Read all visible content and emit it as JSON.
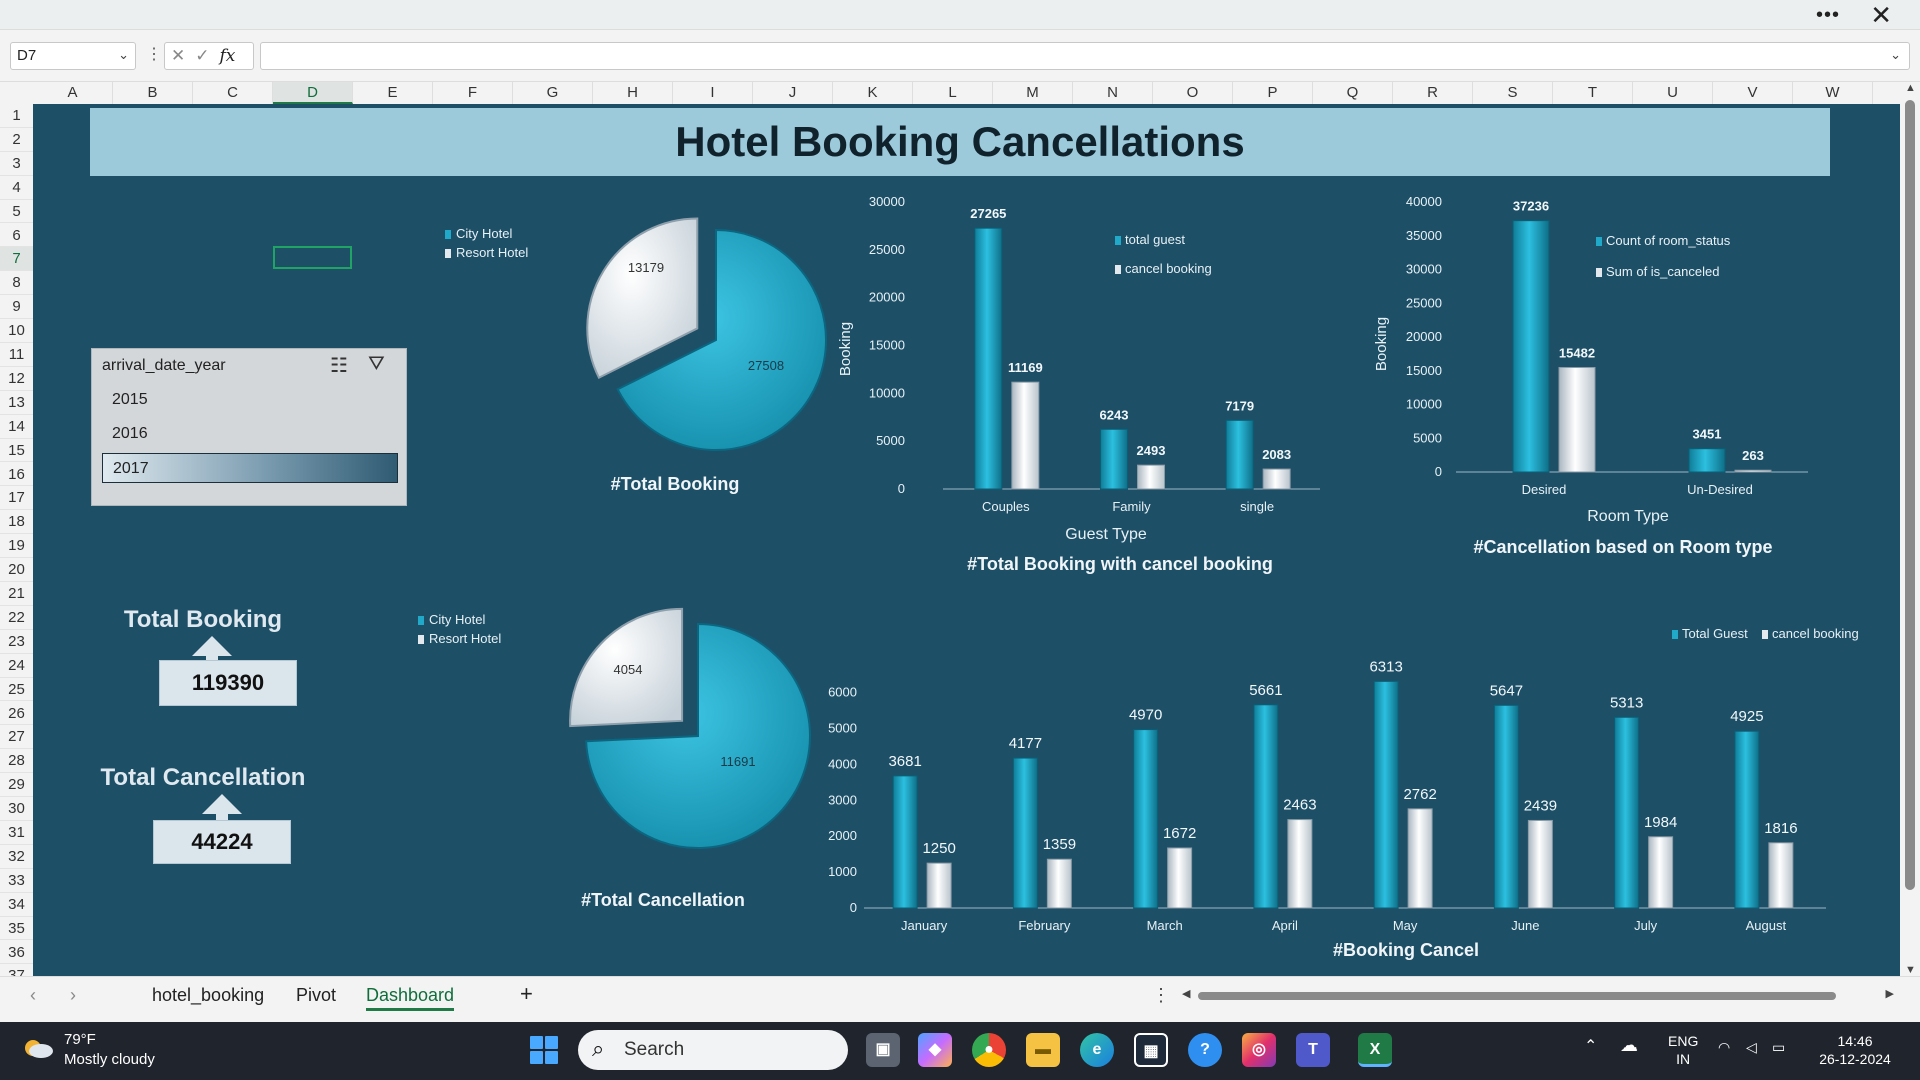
{
  "formula_bar": {
    "name_box": "D7",
    "formula": "",
    "fx": "fx"
  },
  "columns": [
    "A",
    "B",
    "C",
    "D",
    "E",
    "F",
    "G",
    "H",
    "I",
    "J",
    "K",
    "L",
    "M",
    "N",
    "O",
    "P",
    "Q",
    "R",
    "S",
    "T",
    "U",
    "V",
    "W"
  ],
  "rows": [
    "1",
    "2",
    "3",
    "4",
    "5",
    "6",
    "7",
    "8",
    "9",
    "10",
    "11",
    "12",
    "13",
    "14",
    "15",
    "16",
    "17",
    "18",
    "19",
    "20",
    "21",
    "22",
    "23",
    "24",
    "25",
    "26",
    "27",
    "28",
    "29",
    "30",
    "31",
    "32",
    "33",
    "34",
    "35",
    "36",
    "37"
  ],
  "dashboard": {
    "title": "Hotel Booking Cancellations",
    "slicer": {
      "header": "arrival_date_year",
      "items": [
        "2015",
        "2016",
        "2017"
      ],
      "selected": "2017"
    },
    "kpi": {
      "total_booking_label": "Total Booking",
      "total_booking_value": "119390",
      "total_cancellation_label": "Total Cancellation",
      "total_cancellation_value": "44224"
    }
  },
  "chart_data": [
    {
      "type": "pie",
      "title": "#Total Booking",
      "legend": [
        "City Hotel",
        "Resort Hotel"
      ],
      "legend_position": "top-left",
      "values": [
        27508,
        13179
      ],
      "labels": [
        "27508",
        "13179"
      ],
      "colors": [
        "#21a9c9",
        "#e2e8ee"
      ]
    },
    {
      "type": "pie",
      "title": "#Total Cancellation",
      "legend": [
        "City Hotel",
        "Resort Hotel"
      ],
      "legend_position": "top-left",
      "values": [
        11691,
        4054
      ],
      "labels": [
        "11691",
        "4054"
      ],
      "colors": [
        "#21a9c9",
        "#e2e8ee"
      ]
    },
    {
      "type": "bar",
      "title": "#Total Booking with cancel booking",
      "xlabel": "Guest Type",
      "ylabel": "Booking",
      "categories": [
        "Couples",
        "Family",
        "single"
      ],
      "series": [
        {
          "name": "total guest",
          "values": [
            27265,
            6243,
            7179
          ]
        },
        {
          "name": "cancel booking",
          "values": [
            11169,
            2493,
            2083
          ]
        }
      ],
      "ylim": [
        0,
        30000
      ],
      "yticks": [
        "0",
        "5000",
        "10000",
        "15000",
        "20000",
        "25000",
        "30000"
      ],
      "legend_position": "top-right"
    },
    {
      "type": "bar",
      "title": "#Cancellation based on Room type",
      "xlabel": "Room Type",
      "ylabel": "Booking",
      "categories": [
        "Desired",
        "Un-Desired"
      ],
      "series": [
        {
          "name": "Count of room_status",
          "values": [
            37236,
            3451
          ]
        },
        {
          "name": "Sum of is_canceled",
          "values": [
            15482,
            263
          ]
        }
      ],
      "ylim": [
        0,
        40000
      ],
      "yticks": [
        "0",
        "5000",
        "10000",
        "15000",
        "20000",
        "25000",
        "30000",
        "35000",
        "40000"
      ],
      "legend_position": "top-right"
    },
    {
      "type": "bar",
      "title": "#Booking Cancel",
      "xlabel": "",
      "ylabel": "",
      "categories": [
        "January",
        "February",
        "March",
        "April",
        "May",
        "June",
        "July",
        "August"
      ],
      "series": [
        {
          "name": "Total Guest",
          "values": [
            3681,
            4177,
            4970,
            5661,
            6313,
            5647,
            5313,
            4925
          ]
        },
        {
          "name": "cancel booking",
          "values": [
            1250,
            1359,
            1672,
            2463,
            2762,
            2439,
            1984,
            1816
          ]
        }
      ],
      "ylim": [
        0,
        7000
      ],
      "yticks": [
        "0",
        "1000",
        "2000",
        "3000",
        "4000",
        "5000",
        "6000"
      ],
      "legend_position": "top-right"
    }
  ],
  "tabs": {
    "items": [
      "hotel_booking",
      "Pivot",
      "Dashboard"
    ],
    "active": "Dashboard",
    "add": "+"
  },
  "taskbar": {
    "temperature": "79°F",
    "weather": "Mostly cloudy",
    "search_placeholder": "Search",
    "lang_top": "ENG",
    "lang_bottom": "IN",
    "time": "14:46",
    "date": "26-12-2024"
  },
  "colors": {
    "sheet_bg": "#1d4f67",
    "accent": "#21a9c9",
    "secondary": "#e2e8ee",
    "banner": "#9ccadb"
  }
}
